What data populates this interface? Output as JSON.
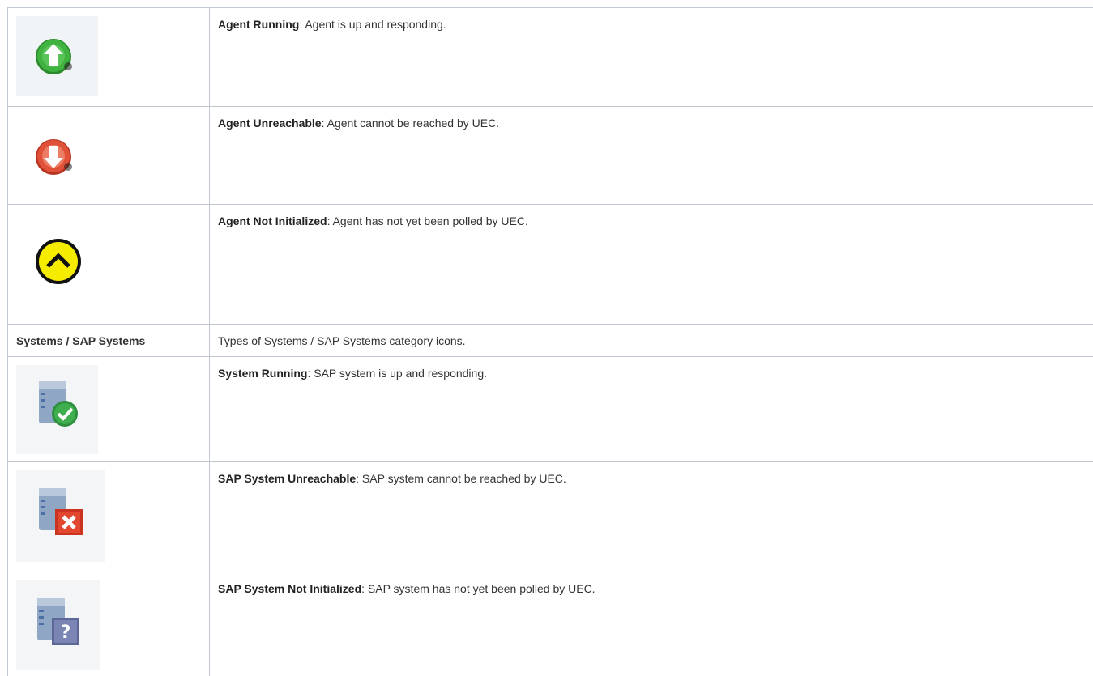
{
  "rows": [
    {
      "title": "Agent Running",
      "text": ": Agent is up and responding.",
      "icon": "agent-running-icon"
    },
    {
      "title": "Agent Unreachable",
      "text": ": Agent cannot be reached by UEC.",
      "icon": "agent-unreachable-icon"
    },
    {
      "title": "Agent Not Initialized",
      "text": ": Agent has not yet been polled by UEC.",
      "icon": "agent-not-initialized-icon"
    }
  ],
  "category": {
    "label": "Systems / SAP Systems",
    "text": "Types of Systems / SAP Systems category icons."
  },
  "system_rows": [
    {
      "title": "System Running",
      "text": ": SAP system is up and responding.",
      "icon": "system-running-icon"
    },
    {
      "title": "SAP System Unreachable",
      "text": ": SAP system cannot be reached by UEC.",
      "icon": "system-unreachable-icon"
    },
    {
      "title": "SAP System Not Initialized",
      "text": ": SAP system has not yet been polled by UEC.",
      "icon": "system-not-initialized-icon"
    }
  ],
  "colors": {
    "border": "#c1c7d0",
    "green": "#3aa83a",
    "red": "#e0513a",
    "yellow": "#f5ec00",
    "server": "#8fa6c4"
  }
}
